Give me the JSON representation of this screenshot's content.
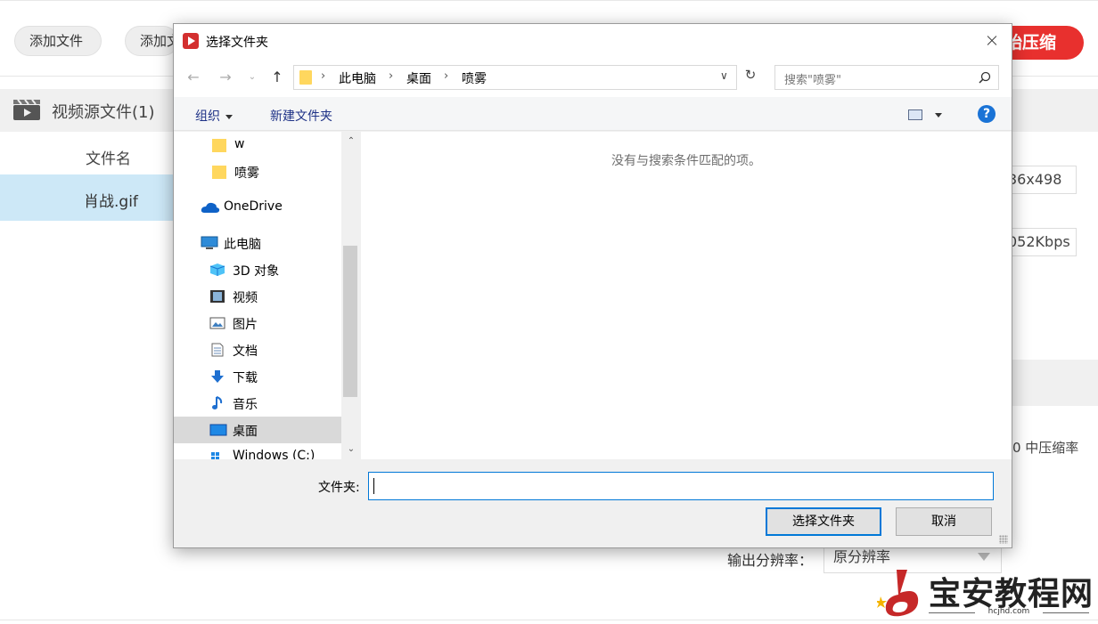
{
  "app": {
    "toolbar": {
      "add_file_label": "添加文件",
      "add_folder_label_partial": "添加文",
      "compress_label_partial": "始压缩"
    },
    "source": {
      "header_label": "视频源文件(1)",
      "column_filename": "文件名",
      "file_name": "肖战.gif"
    },
    "right_panel": {
      "resolution_partial": "36x498",
      "bitrate_partial": "052Kbps",
      "ratio_partial": "0  中压缩率"
    },
    "output": {
      "resolution_label": "输出分辨率：",
      "resolution_value": "原分辨率"
    }
  },
  "dialog": {
    "title": "选择文件夹",
    "breadcrumb": [
      "此电脑",
      "桌面",
      "喷雾"
    ],
    "search_placeholder": "搜索\"喷雾\"",
    "organize_label": "组织",
    "new_folder_label": "新建文件夹",
    "help_glyph": "?",
    "nav_items": [
      {
        "label": "w",
        "icon": "folder-icon"
      },
      {
        "label": "喷雾",
        "icon": "folder-icon"
      },
      {
        "label": "OneDrive",
        "icon": "cloud-icon"
      },
      {
        "label": "此电脑",
        "icon": "computer-icon"
      },
      {
        "label": "3D 对象",
        "icon": "cube-icon"
      },
      {
        "label": "视频",
        "icon": "video-icon"
      },
      {
        "label": "图片",
        "icon": "picture-icon"
      },
      {
        "label": "文档",
        "icon": "document-icon"
      },
      {
        "label": "下载",
        "icon": "download-icon"
      },
      {
        "label": "音乐",
        "icon": "music-icon"
      },
      {
        "label": "桌面",
        "icon": "desktop-icon",
        "selected": true
      },
      {
        "label": "Windows (C:)",
        "icon": "drive-icon"
      }
    ],
    "empty_message": "没有与搜索条件匹配的项。",
    "folder_field_label": "文件夹:",
    "folder_field_value": "",
    "select_button": "选择文件夹",
    "cancel_button": "取消"
  },
  "watermark": {
    "text": "宝安教程网",
    "sub": "hcjhd.com"
  },
  "colors": {
    "accent_red": "#e8302e",
    "selection_blue": "#cde8f7",
    "focus_blue": "#0078d7",
    "link_blue": "#1e3287"
  }
}
